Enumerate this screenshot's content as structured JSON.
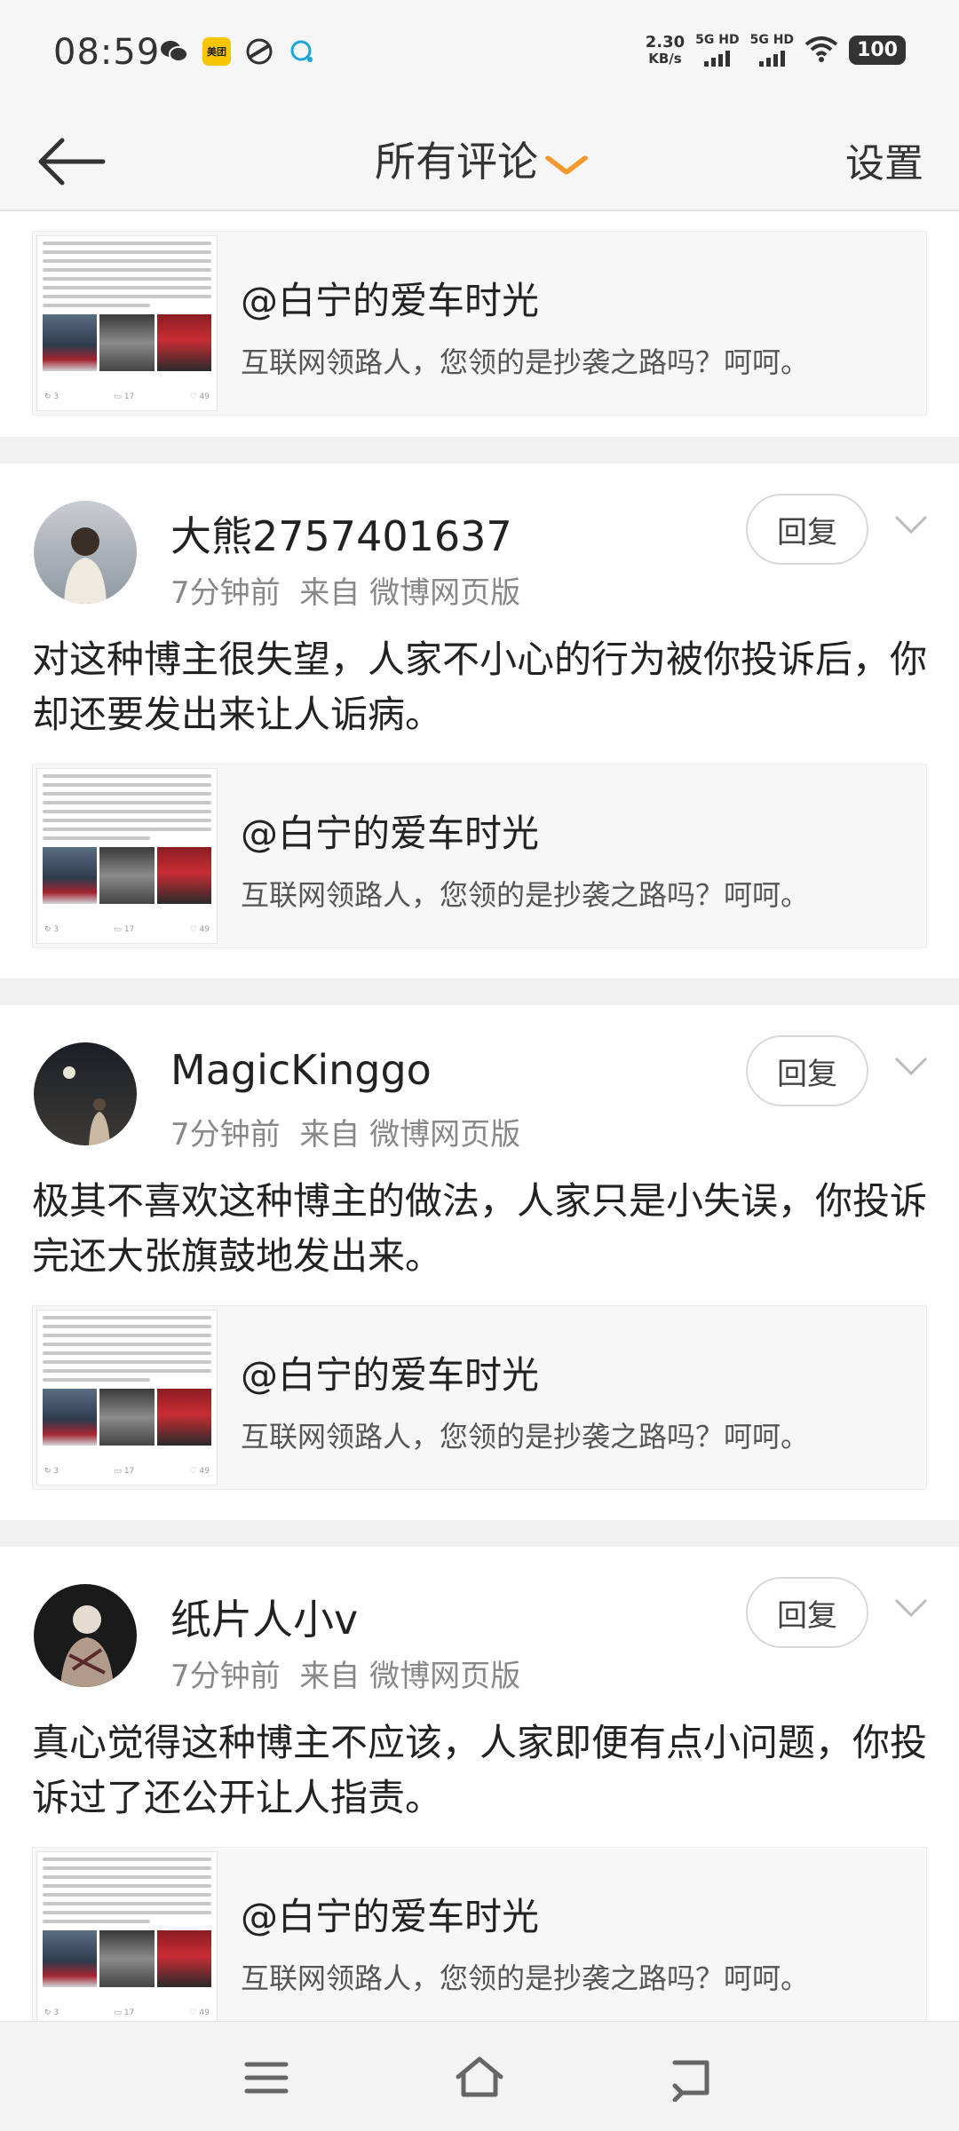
{
  "status_bar": {
    "time": "08:59",
    "net_speed_value": "2.30",
    "net_speed_unit": "KB/s",
    "sim1_label": "5G HD",
    "sim2_label": "5G HD",
    "battery": "100",
    "meituan_label": "美团",
    "icons": [
      "wechat-icon",
      "meituan-icon",
      "app-icon",
      "qq-icon",
      "wifi-icon"
    ]
  },
  "nav": {
    "title": "所有评论",
    "settings": "设置"
  },
  "shared_quote": {
    "author": "@白宁的爱车时光",
    "text": "互联网领路人，您领的是抄袭之路吗？呵呵。"
  },
  "comments": [
    {
      "username": "大熊2757401637",
      "time": "7分钟前",
      "source": "来自 微博网页版",
      "text": "对这种博主很失望，人家不小心的行为被你投诉后，你却还要发出来让人诟病。",
      "reply": "回复"
    },
    {
      "username": "MagicKinggo",
      "time": "7分钟前",
      "source": "来自 微博网页版",
      "text": "极其不喜欢这种博主的做法，人家只是小失误，你投诉完还大张旗鼓地发出来。",
      "reply": "回复"
    },
    {
      "username": "纸片人小v",
      "time": "7分钟前",
      "source": "来自 微博网页版",
      "text": "真心觉得这种博主不应该，人家即便有点小问题，你投诉过了还公开让人指责。",
      "reply": "回复"
    }
  ],
  "colors": {
    "accent": "#f29a2e",
    "background": "#ffffff",
    "divider": "#f0f0f0"
  }
}
